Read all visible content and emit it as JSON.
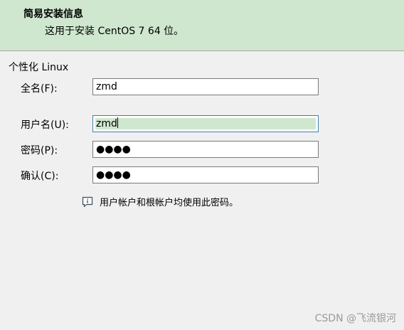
{
  "header": {
    "title": "简易安装信息",
    "subtitle": "这用于安装 CentOS 7 64 位。"
  },
  "section": {
    "label": "个性化 Linux"
  },
  "form": {
    "fullname": {
      "label": "全名(F):",
      "value": "zmd"
    },
    "username": {
      "label": "用户名(U):",
      "value": "zmd"
    },
    "password": {
      "label": "密码(P):",
      "value_masked": "●●●●"
    },
    "confirm": {
      "label": "确认(C):",
      "value_masked": "●●●●"
    }
  },
  "hint": {
    "icon": "info-speech-icon",
    "text": "用户帐户和根帐户均使用此密码。"
  },
  "watermark": "CSDN @飞流银河",
  "colors": {
    "header_bg": "#cfe7cf",
    "window_bg": "#f0f0f0",
    "focus_border": "#3c7fb1"
  }
}
